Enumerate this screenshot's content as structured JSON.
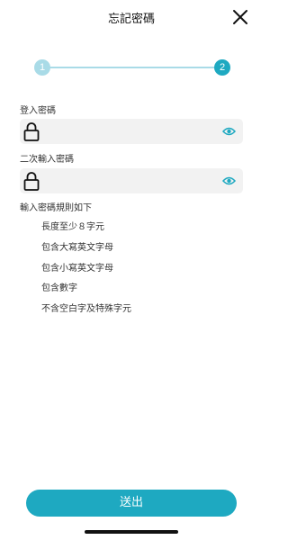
{
  "header": {
    "title": "忘記密碼",
    "close_icon": "close-icon"
  },
  "stepper": {
    "steps": [
      "1",
      "2"
    ],
    "current": 2,
    "active_color": "#1ea9c1",
    "inactive_color": "#a9dbe7"
  },
  "form": {
    "password_label": "登入密碼",
    "password_value": "",
    "confirm_label": "二次輸入密碼",
    "confirm_value": "",
    "field_icons": [
      "lock-icon",
      "eye-icon"
    ]
  },
  "rules": {
    "title": "輸入密碼規則如下",
    "items": [
      "長度至少８字元",
      "包含大寫英文字母",
      "包含小寫英文字母",
      "包含數字",
      "不含空白字及特殊字元"
    ]
  },
  "submit_label": "送出",
  "colors": {
    "accent": "#1ea9c1",
    "field_bg": "#f2f2f2"
  }
}
